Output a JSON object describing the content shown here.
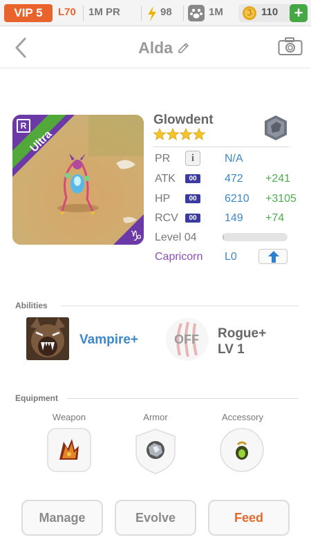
{
  "status_bar": {
    "vip": "VIP 5",
    "level": "L70",
    "pr": "1M PR",
    "energy": "98",
    "paw": "1M",
    "coins": "110",
    "plus": "+"
  },
  "header": {
    "title": "Alda"
  },
  "monster": {
    "name": "Glowdent",
    "stars": 4,
    "rarity": "Ultra",
    "rarity_badge": "R",
    "stats": [
      {
        "label": "PR",
        "value": "N/A",
        "bonus": ""
      },
      {
        "label": "ATK",
        "badge": "00",
        "value": "472",
        "bonus": "+241"
      },
      {
        "label": "HP",
        "badge": "00",
        "value": "6210",
        "bonus": "+3105"
      },
      {
        "label": "RCV",
        "badge": "00",
        "value": "149",
        "bonus": "+74"
      }
    ],
    "level_label": "Level 04",
    "level_progress": 0.02,
    "zodiac": "Capricorn",
    "zodiac_level": "L0"
  },
  "abilities": {
    "label": "Abilities",
    "primary": "Vampire+",
    "secondary_state": "OFF",
    "secondary_name": "Rogue+",
    "secondary_level": "LV 1"
  },
  "equipment": {
    "label": "Equipment",
    "slots": [
      {
        "label": "Weapon"
      },
      {
        "label": "Armor"
      },
      {
        "label": "Accessory"
      }
    ]
  },
  "actions": {
    "manage": "Manage",
    "evolve": "Evolve",
    "feed": "Feed"
  },
  "colors": {
    "accent_orange": "#e8642c",
    "stat_blue": "#3b87c9",
    "bonus_green": "#4cae4c",
    "zodiac_purple": "#8a4fb8",
    "rarity_green": "#52a83a"
  }
}
